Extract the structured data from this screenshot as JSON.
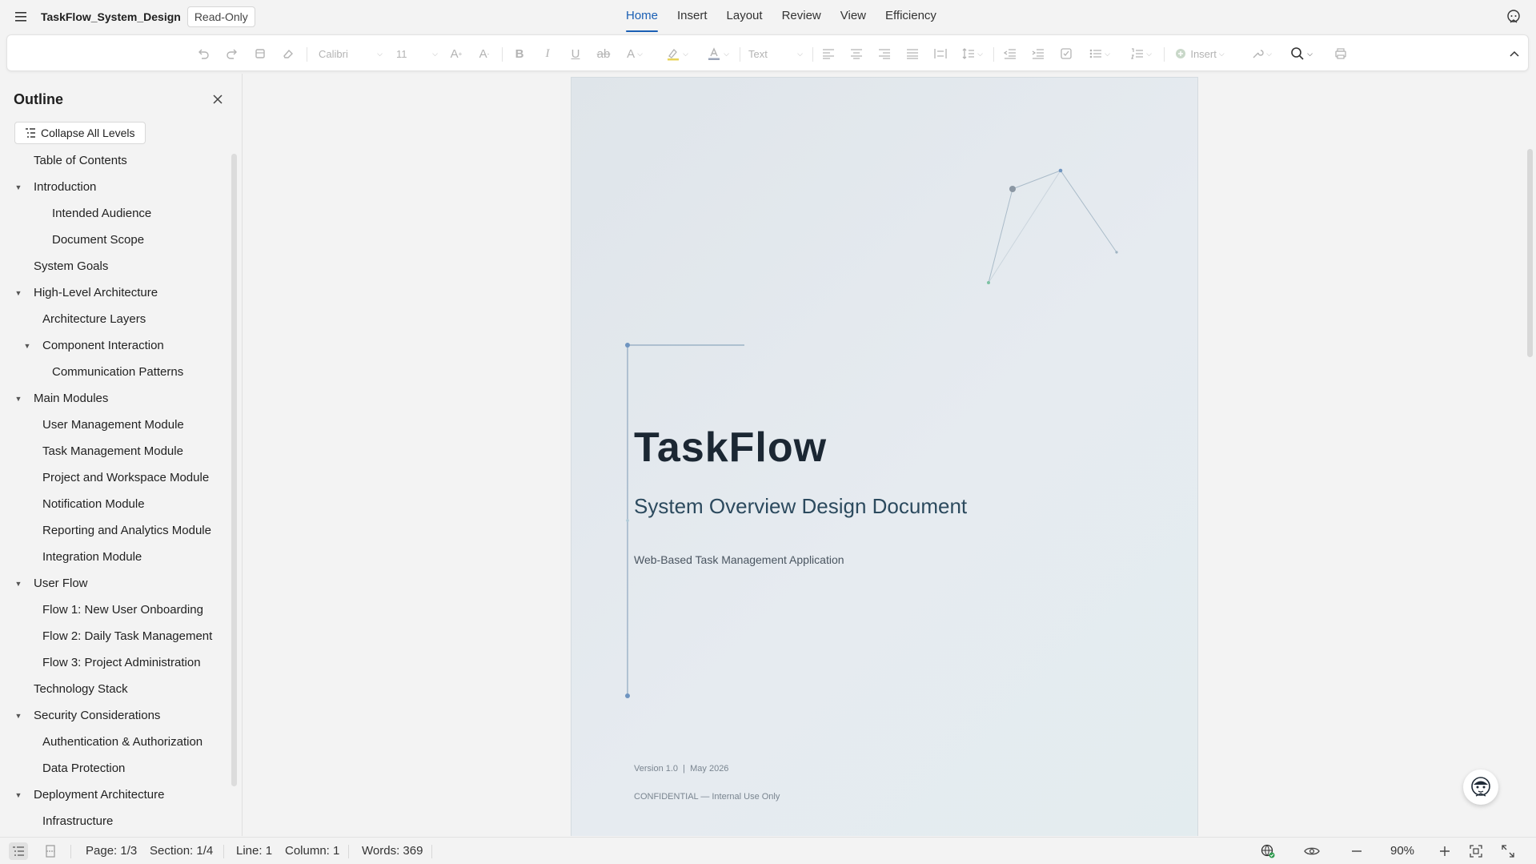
{
  "app": {
    "doc_title": "TaskFlow_System_Design",
    "mode_badge": "Read-Only",
    "tabs": [
      "Home",
      "Insert",
      "Layout",
      "Review",
      "View",
      "Efficiency"
    ],
    "active_tab": "Home"
  },
  "toolbar": {
    "font_name": "Calibri",
    "font_size": "11",
    "style_name": "Text",
    "insert_label": "Insert"
  },
  "outline": {
    "title": "Outline",
    "collapse_label": "Collapse All Levels",
    "items": [
      {
        "label": "Table of Contents",
        "level": 1,
        "toggle": ""
      },
      {
        "label": "Introduction",
        "level": 1,
        "toggle": "▼"
      },
      {
        "label": "Intended Audience",
        "level": 3,
        "toggle": ""
      },
      {
        "label": "Document Scope",
        "level": 3,
        "toggle": ""
      },
      {
        "label": "System Goals",
        "level": 1,
        "toggle": ""
      },
      {
        "label": "High-Level Architecture",
        "level": 1,
        "toggle": "▼"
      },
      {
        "label": "Architecture Layers",
        "level": 2,
        "toggle": ""
      },
      {
        "label": "Component Interaction",
        "level": 2,
        "toggle": "▼"
      },
      {
        "label": "Communication Patterns",
        "level": 3,
        "toggle": ""
      },
      {
        "label": "Main Modules",
        "level": 1,
        "toggle": "▼"
      },
      {
        "label": "User Management Module",
        "level": 2,
        "toggle": ""
      },
      {
        "label": "Task Management Module",
        "level": 2,
        "toggle": ""
      },
      {
        "label": "Project and Workspace Module",
        "level": 2,
        "toggle": ""
      },
      {
        "label": "Notification Module",
        "level": 2,
        "toggle": ""
      },
      {
        "label": "Reporting and Analytics Module",
        "level": 2,
        "toggle": ""
      },
      {
        "label": "Integration Module",
        "level": 2,
        "toggle": ""
      },
      {
        "label": "User Flow",
        "level": 1,
        "toggle": "▼"
      },
      {
        "label": "Flow 1: New User Onboarding",
        "level": 2,
        "toggle": ""
      },
      {
        "label": "Flow 2: Daily Task Management",
        "level": 2,
        "toggle": ""
      },
      {
        "label": "Flow 3: Project Administration",
        "level": 2,
        "toggle": ""
      },
      {
        "label": "Technology Stack",
        "level": 1,
        "toggle": ""
      },
      {
        "label": "Security Considerations",
        "level": 1,
        "toggle": "▼"
      },
      {
        "label": "Authentication & Authorization",
        "level": 2,
        "toggle": ""
      },
      {
        "label": "Data Protection",
        "level": 2,
        "toggle": ""
      },
      {
        "label": "Deployment Architecture",
        "level": 1,
        "toggle": "▼"
      },
      {
        "label": "Infrastructure",
        "level": 2,
        "toggle": ""
      }
    ]
  },
  "page": {
    "title": "TaskFlow",
    "subtitle": "System Overview Design Document",
    "tagline": "Web-Based Task Management Application",
    "version": "Version 1.0  |  May 2026",
    "confidential": "CONFIDENTIAL — Internal Use Only"
  },
  "status": {
    "page": "Page: 1/3",
    "section": "Section: 1/4",
    "line": "Line: 1",
    "column": "Column: 1",
    "words": "Words: 369",
    "zoom": "90%"
  },
  "colors": {
    "accent": "#1a5fb4",
    "page_bg": "#e3e9ee",
    "title": "#1b2733",
    "subtitle": "#2c4a5e"
  }
}
